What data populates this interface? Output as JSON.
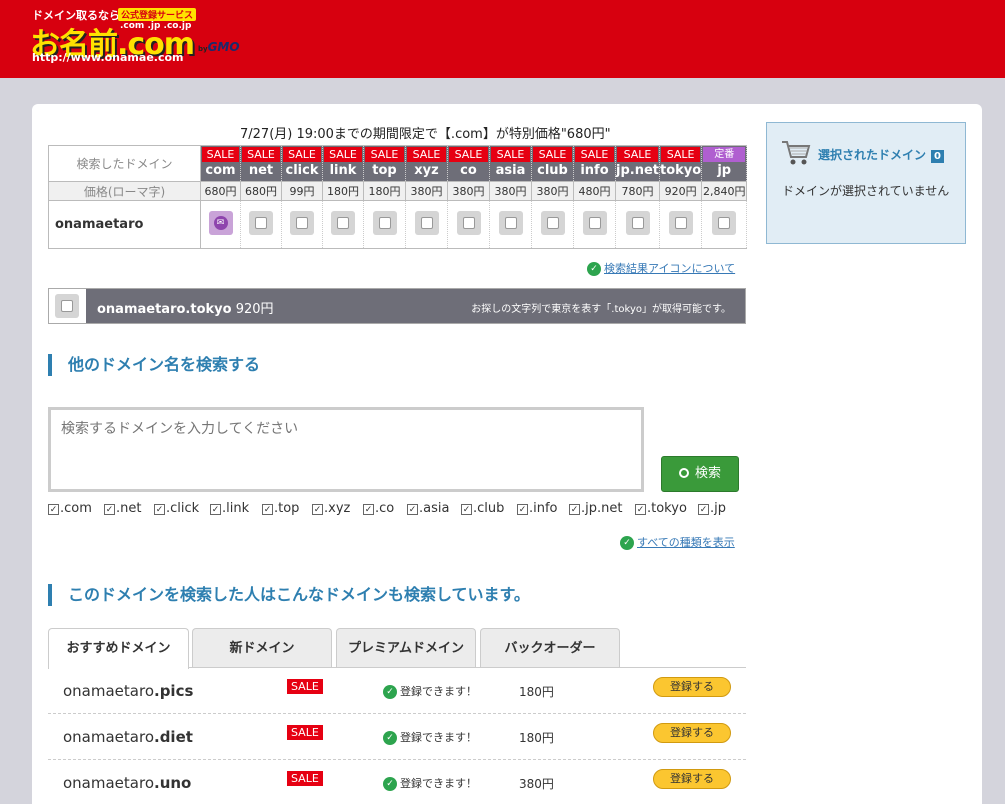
{
  "logo": {
    "tagline": "ドメイン取るなら",
    "badge": "公式登録サービス",
    "tlds": ".com .jp .co.jp",
    "main": "お名前.com",
    "by": "by",
    "gmo": "GMO",
    "url": "http://www.onamae.com"
  },
  "promo": "7/27(月) 19:00までの期間限定で【.com】が特別価格\"680円\"",
  "results": {
    "searched_label": "検索したドメイン",
    "price_label": "価格(ローマ字)",
    "name": "onamaetaro",
    "tlds": [
      {
        "tag": "SALE",
        "name": "com",
        "price": "680円",
        "state": "mail"
      },
      {
        "tag": "SALE",
        "name": "net",
        "price": "680円",
        "state": "box"
      },
      {
        "tag": "SALE",
        "name": "click",
        "price": "99円",
        "state": "box"
      },
      {
        "tag": "SALE",
        "name": "link",
        "price": "180円",
        "state": "box"
      },
      {
        "tag": "SALE",
        "name": "top",
        "price": "180円",
        "state": "box"
      },
      {
        "tag": "SALE",
        "name": "xyz",
        "price": "380円",
        "state": "box"
      },
      {
        "tag": "SALE",
        "name": "co",
        "price": "380円",
        "state": "box"
      },
      {
        "tag": "SALE",
        "name": "asia",
        "price": "380円",
        "state": "box"
      },
      {
        "tag": "SALE",
        "name": "club",
        "price": "380円",
        "state": "box"
      },
      {
        "tag": "SALE",
        "name": "info",
        "price": "480円",
        "state": "box"
      },
      {
        "tag": "SALE",
        "name": "jp.net",
        "price": "780円",
        "state": "box"
      },
      {
        "tag": "SALE",
        "name": "tokyo",
        "price": "920円",
        "state": "box"
      },
      {
        "tag": "定番",
        "name": "jp",
        "price": "2,840円",
        "state": "box"
      }
    ],
    "icon_link": "検索結果アイコンについて"
  },
  "tokyo": {
    "domain": "onamaetaro.tokyo",
    "price": "920円",
    "note": "お探しの文字列で東京を表す「.tokyo」が取得可能です。"
  },
  "search_section": {
    "heading": "他のドメイン名を検索する",
    "placeholder": "検索するドメインを入力してください",
    "button": "検索",
    "tld_checks": [
      ".com",
      ".net",
      ".click",
      ".link",
      ".top",
      ".xyz",
      ".co",
      ".asia",
      ".club",
      ".info",
      ".jp.net",
      ".tokyo",
      ".jp"
    ],
    "show_all": "すべての種類を表示"
  },
  "related": {
    "heading": "このドメインを検索した人はこんなドメインも検索しています。",
    "tabs": [
      "おすすめドメイン",
      "新ドメイン",
      "プレミアムドメイン",
      "バックオーダー"
    ],
    "rows": [
      {
        "base": "onamaetaro",
        "tld": ".pics",
        "tag": "SALE",
        "status": "登録できます！",
        "price": "180円",
        "button": "登録する"
      },
      {
        "base": "onamaetaro",
        "tld": ".diet",
        "tag": "SALE",
        "status": "登録できます！",
        "price": "180円",
        "button": "登録する"
      },
      {
        "base": "onamaetaro",
        "tld": ".uno",
        "tag": "SALE",
        "status": "登録できます！",
        "price": "380円",
        "button": "登録する"
      }
    ]
  },
  "cart": {
    "title": "選択されたドメイン",
    "count": "0",
    "empty": "ドメインが選択されていません"
  },
  "colors": {
    "header_red": "#d7000f",
    "sale_red": "#e60012",
    "accent_blue": "#2e7fb0",
    "button_green": "#3a9a3a",
    "register_yellow": "#fbc630"
  }
}
